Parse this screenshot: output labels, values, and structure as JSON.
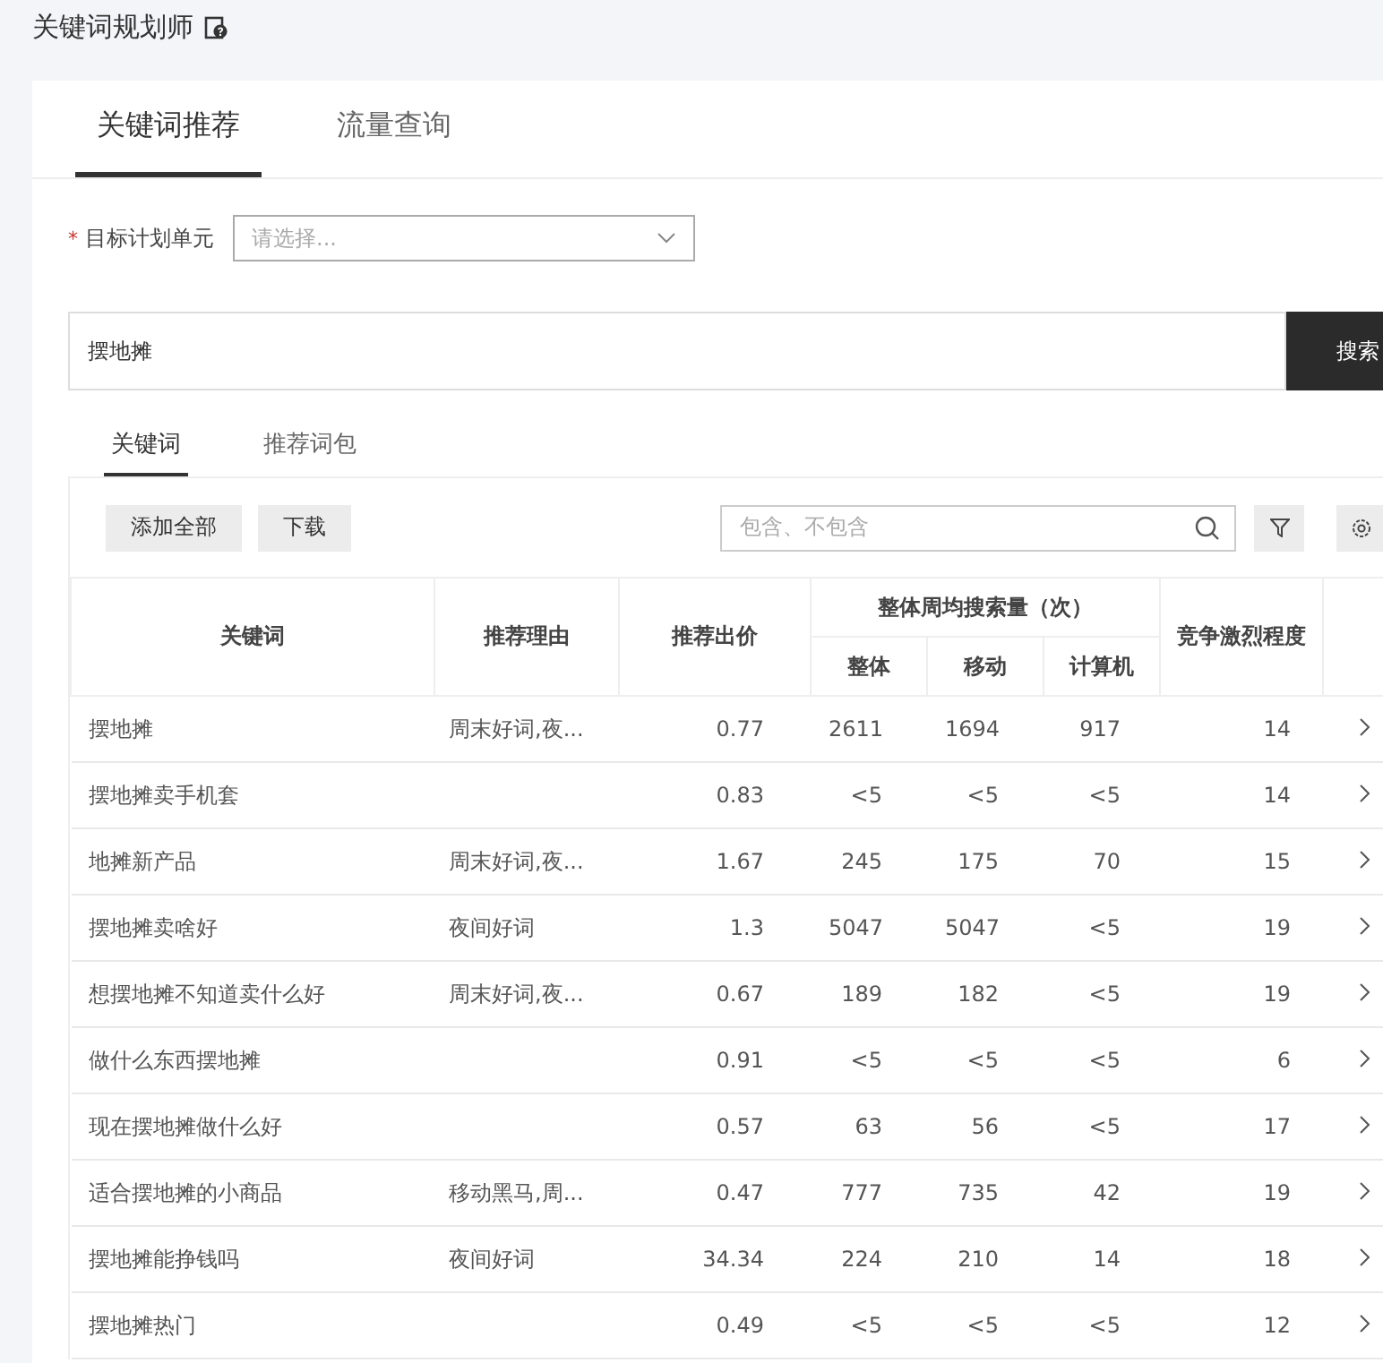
{
  "page_title": "关键词规划师",
  "tabs": [
    {
      "label": "关键词推荐",
      "selected": true
    },
    {
      "label": "流量查询",
      "selected": false
    }
  ],
  "unit_field": {
    "label": "目标计划单元",
    "required_mark": "*",
    "placeholder": "请选择..."
  },
  "search": {
    "value": "摆地摊",
    "button": "搜索"
  },
  "sub_tabs": [
    {
      "label": "关键词",
      "selected": true
    },
    {
      "label": "推荐词包",
      "selected": false
    }
  ],
  "toolbar": {
    "buttons": [
      "添加全部",
      "下载"
    ],
    "filter_placeholder": "包含、不包含"
  },
  "table": {
    "columns": [
      "关键词",
      "推荐理由",
      "推荐出价"
    ],
    "group": "整体周均搜索量（次）",
    "sub_columns": [
      "整体",
      "移动",
      "计算机"
    ],
    "last_column": "竞争激烈程度",
    "rows": [
      {
        "keyword": "摆地摊",
        "reason": "周末好词,夜...",
        "bid": "0.77",
        "overall": "2611",
        "mobile": "1694",
        "pc": "917",
        "competition": "14"
      },
      {
        "keyword": "摆地摊卖手机套",
        "reason": "",
        "bid": "0.83",
        "overall": "<5",
        "mobile": "<5",
        "pc": "<5",
        "competition": "14"
      },
      {
        "keyword": "地摊新产品",
        "reason": "周末好词,夜...",
        "bid": "1.67",
        "overall": "245",
        "mobile": "175",
        "pc": "70",
        "competition": "15"
      },
      {
        "keyword": "摆地摊卖啥好",
        "reason": "夜间好词",
        "bid": "1.3",
        "overall": "5047",
        "mobile": "5047",
        "pc": "<5",
        "competition": "19"
      },
      {
        "keyword": "想摆地摊不知道卖什么好",
        "reason": "周末好词,夜...",
        "bid": "0.67",
        "overall": "189",
        "mobile": "182",
        "pc": "<5",
        "competition": "19"
      },
      {
        "keyword": "做什么东西摆地摊",
        "reason": "",
        "bid": "0.91",
        "overall": "<5",
        "mobile": "<5",
        "pc": "<5",
        "competition": "6"
      },
      {
        "keyword": "现在摆地摊做什么好",
        "reason": "",
        "bid": "0.57",
        "overall": "63",
        "mobile": "56",
        "pc": "<5",
        "competition": "17"
      },
      {
        "keyword": "适合摆地摊的小商品",
        "reason": "移动黑马,周...",
        "bid": "0.47",
        "overall": "777",
        "mobile": "735",
        "pc": "42",
        "competition": "19"
      },
      {
        "keyword": "摆地摊能挣钱吗",
        "reason": "夜间好词",
        "bid": "34.34",
        "overall": "224",
        "mobile": "210",
        "pc": "14",
        "competition": "18"
      },
      {
        "keyword": "摆地摊热门",
        "reason": "",
        "bid": "0.49",
        "overall": "<5",
        "mobile": "<5",
        "pc": "<5",
        "competition": "12"
      }
    ]
  }
}
